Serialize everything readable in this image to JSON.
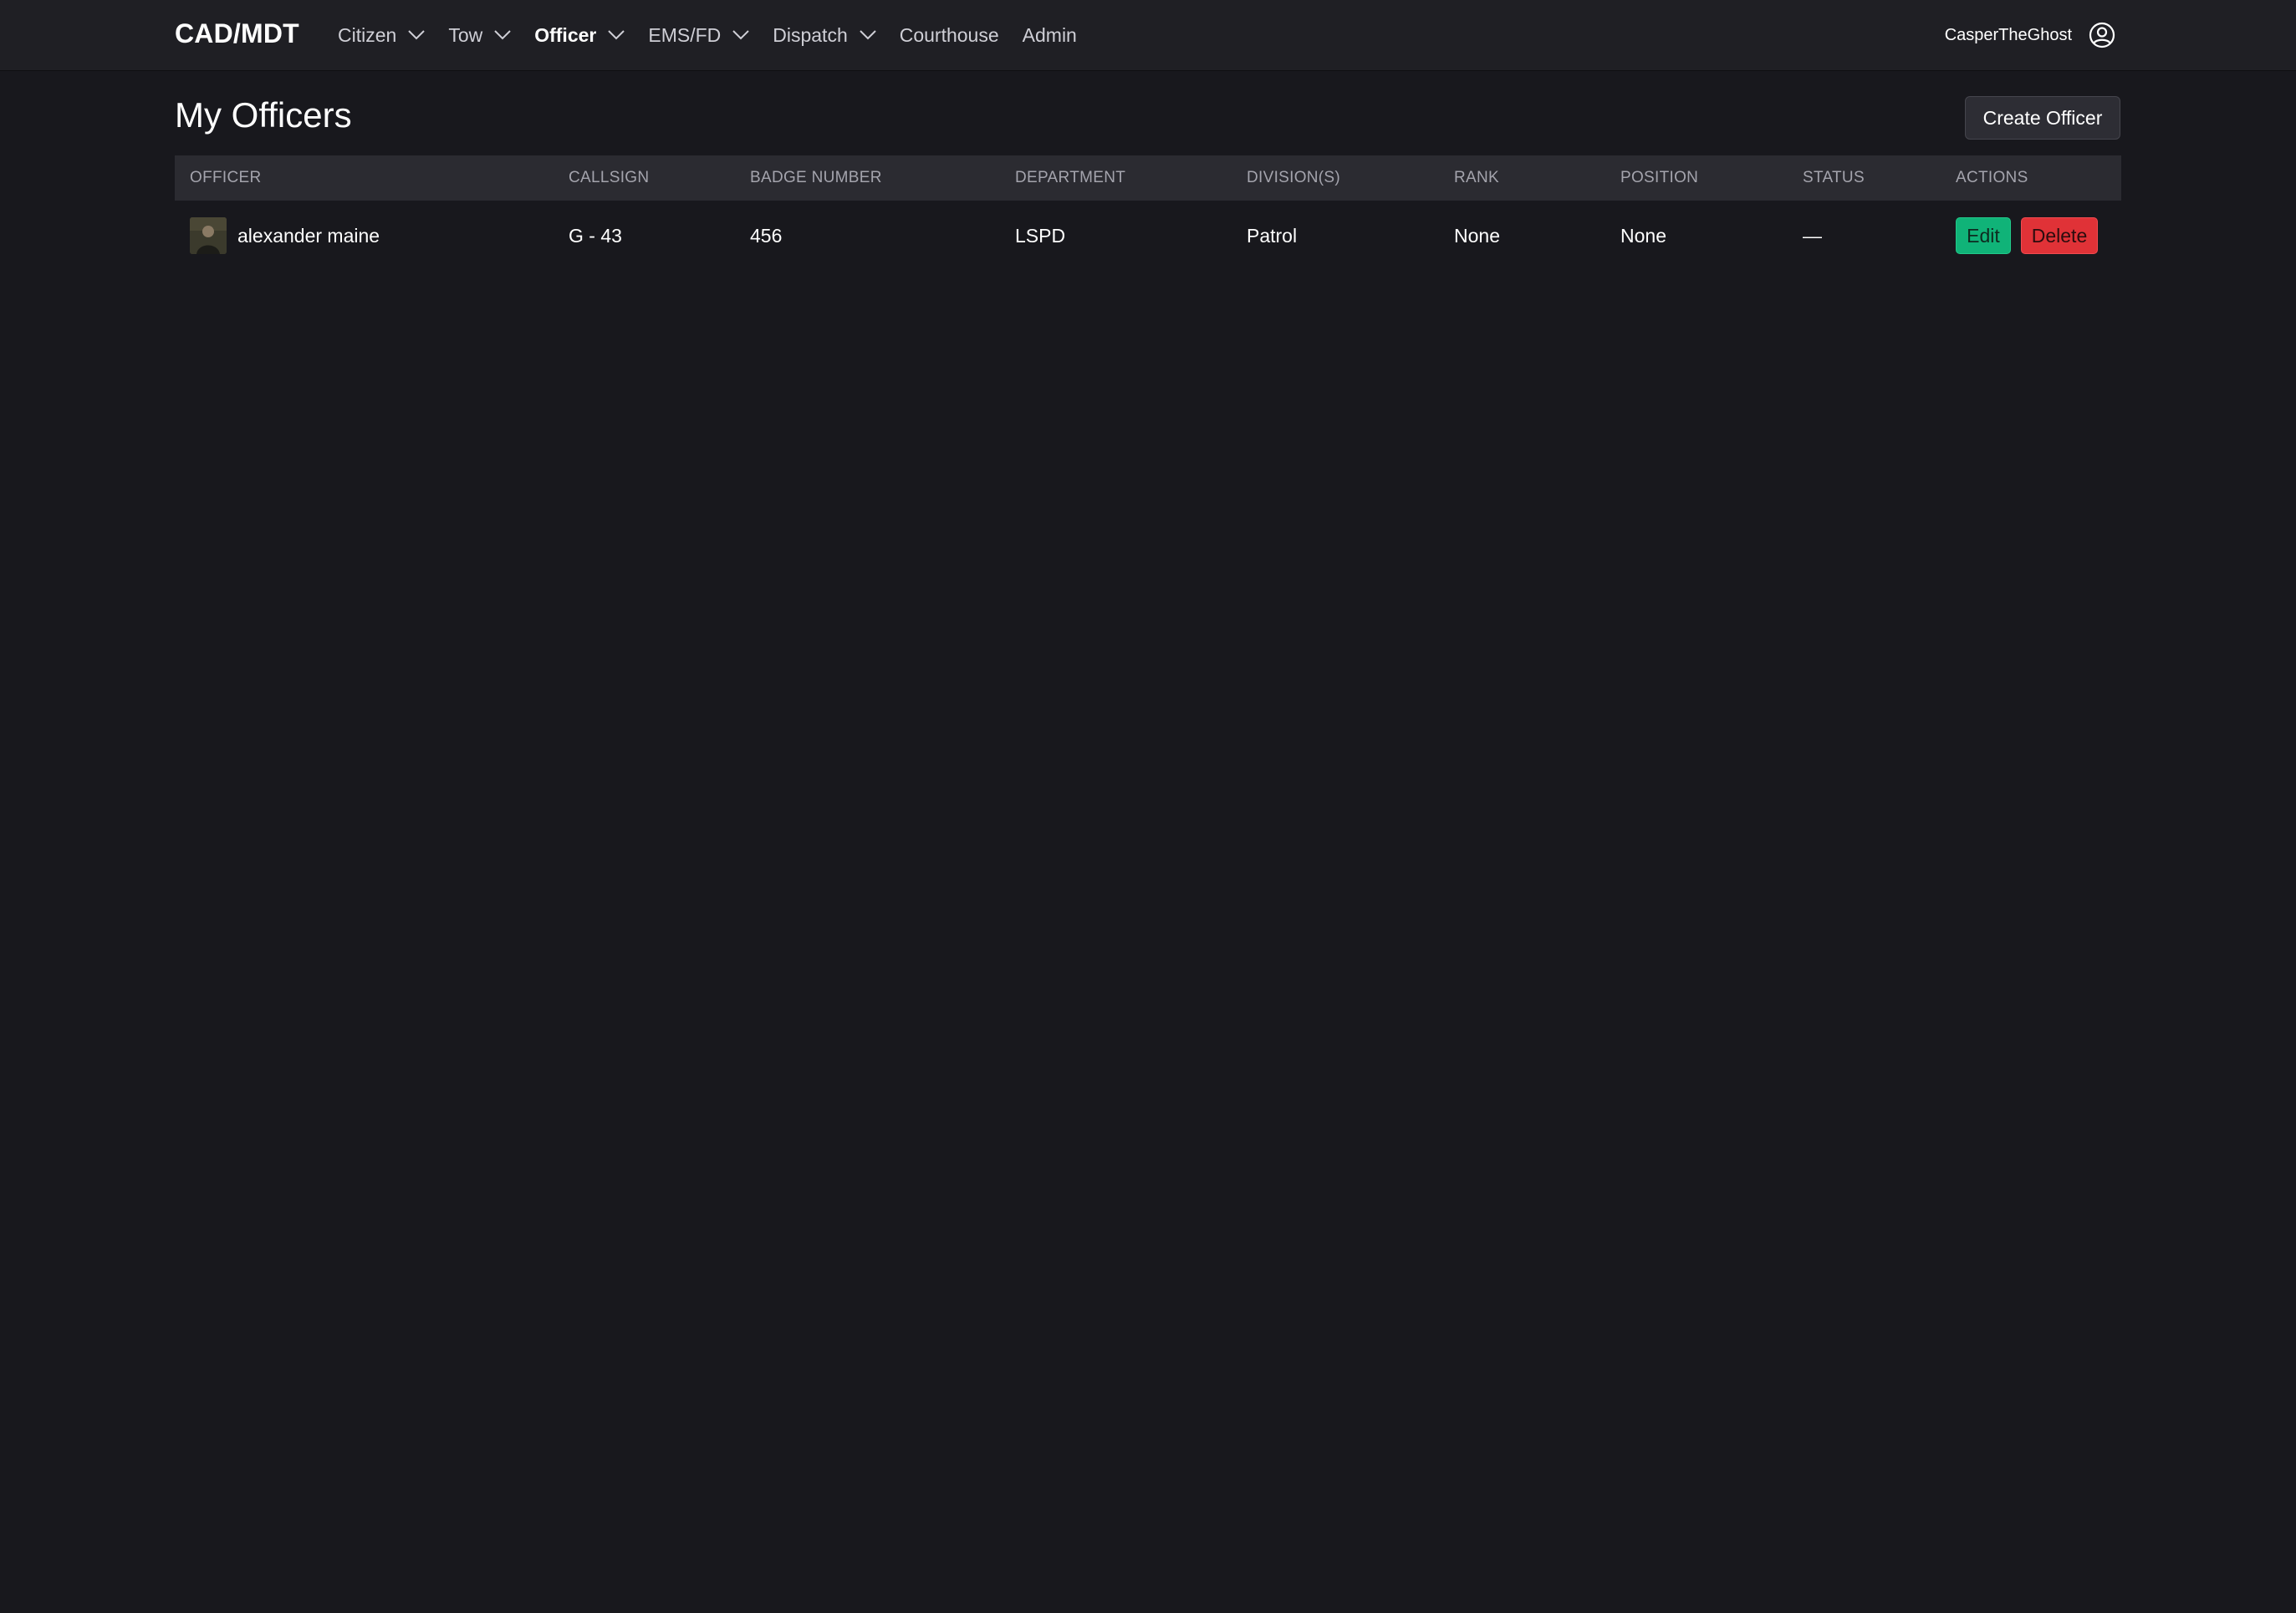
{
  "nav": {
    "brand": "CAD/MDT",
    "items": [
      {
        "label": "Citizen",
        "dropdown": true,
        "active": false
      },
      {
        "label": "Tow",
        "dropdown": true,
        "active": false
      },
      {
        "label": "Officer",
        "dropdown": true,
        "active": true
      },
      {
        "label": "EMS/FD",
        "dropdown": true,
        "active": false
      },
      {
        "label": "Dispatch",
        "dropdown": true,
        "active": false
      },
      {
        "label": "Courthouse",
        "dropdown": false,
        "active": false
      },
      {
        "label": "Admin",
        "dropdown": false,
        "active": false
      }
    ],
    "username": "CasperTheGhost",
    "user_icon": "user-circle-icon"
  },
  "page": {
    "title": "My Officers",
    "create_button": "Create Officer"
  },
  "table": {
    "headers": [
      "OFFICER",
      "CALLSIGN",
      "BADGE NUMBER",
      "DEPARTMENT",
      "DIVISION(S)",
      "RANK",
      "POSITION",
      "STATUS",
      "ACTIONS"
    ],
    "rows": [
      {
        "officer": "alexander maine",
        "callsign": "G - 43",
        "badge_number": "456",
        "department": "LSPD",
        "divisions": "Patrol",
        "rank": "None",
        "position": "None",
        "status": "—",
        "edit_label": "Edit",
        "delete_label": "Delete"
      }
    ]
  },
  "colors": {
    "background": "#18181d",
    "navbar": "#1f1f24",
    "table_header": "#2b2b31",
    "edit": "#10b378",
    "delete": "#e03237"
  }
}
